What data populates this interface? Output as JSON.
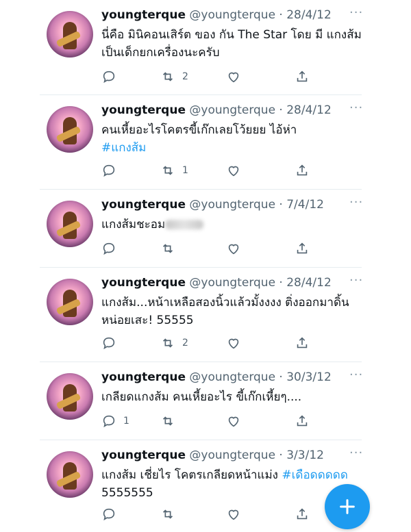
{
  "tweets": [
    {
      "name": "youngterque",
      "handle": "@youngterque · 28/4/12",
      "text": "นี่คือ มินิคอนเสิร์ต ของ กัน The Star โดย มี แกงส้มเป็นเด็กยกเครื่องนะครับ",
      "hashtag": "",
      "text_after": "",
      "reply_count": "",
      "retweet_count": "2"
    },
    {
      "name": "youngterque",
      "handle": "@youngterque · 28/4/12",
      "text": "คนเหี้ยอะไรโคตรขี้เก๊กเลยโว้ยยย ไอ้ห่า",
      "hashtag": "#แกงส้ม",
      "text_after": "",
      "reply_count": "",
      "retweet_count": "1"
    },
    {
      "name": "youngterque",
      "handle": "@youngterque · 7/4/12",
      "text": "แกงส้มชะอม",
      "hashtag": "",
      "text_after": "",
      "reply_count": "",
      "retweet_count": ""
    },
    {
      "name": "youngterque",
      "handle": "@youngterque · 28/4/12",
      "text": "แกงส้ม...หน้าเหลือสองนิ้วแล้วมั้งงงง ติ่งออกมาดิ้นหน่อยเสะ! 55555",
      "hashtag": "",
      "text_after": "",
      "reply_count": "",
      "retweet_count": "2"
    },
    {
      "name": "youngterque",
      "handle": "@youngterque · 30/3/12",
      "text": "เกลียดแกงส้ม คนเหี้ยอะไร ขี้เก๊กเหี้ยๆ....",
      "hashtag": "",
      "text_after": "",
      "reply_count": "1",
      "retweet_count": ""
    },
    {
      "name": "youngterque",
      "handle": "@youngterque · 3/3/12",
      "text": "แกงส้ม เชี่ยไร โคตรเกลียดหน้าแม่ง",
      "hashtag": "#เดือดดดดด",
      "text_after": "5555555",
      "reply_count": "",
      "retweet_count": ""
    }
  ],
  "more_label": "···",
  "colors": {
    "accent": "#1d9bf0",
    "muted": "#536471",
    "divider": "#e6ecf0"
  }
}
